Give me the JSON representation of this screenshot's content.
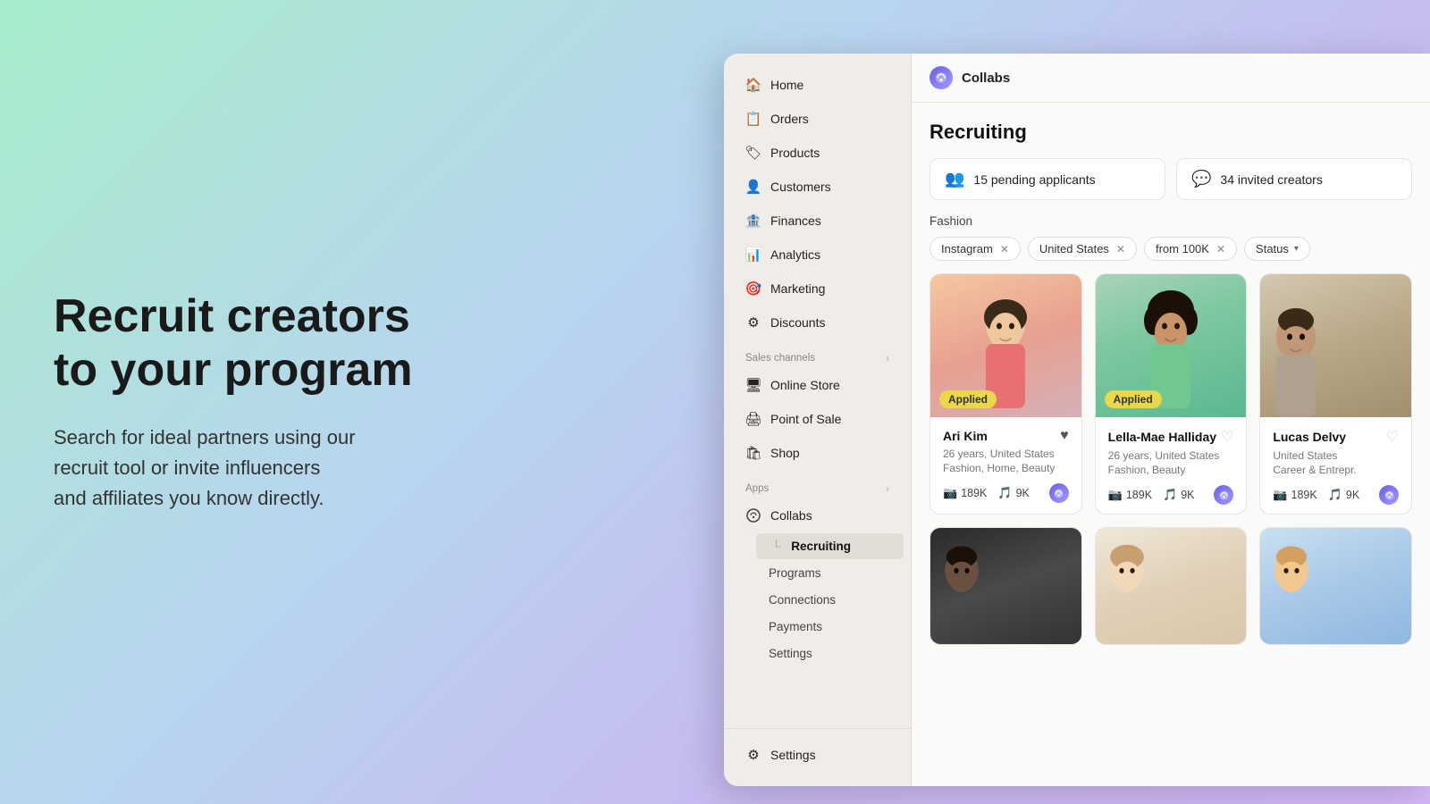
{
  "marketing": {
    "title": "Recruit creators\nto your program",
    "subtitle": "Search for ideal partners using our\nrecruit tool or invite influencers\nand affiliates you know directly."
  },
  "sidebar": {
    "main_items": [
      {
        "id": "home",
        "label": "Home",
        "icon": "🏠"
      },
      {
        "id": "orders",
        "label": "Orders",
        "icon": "📋"
      },
      {
        "id": "products",
        "label": "Products",
        "icon": "🏷"
      },
      {
        "id": "customers",
        "label": "Customers",
        "icon": "👤"
      },
      {
        "id": "finances",
        "label": "Finances",
        "icon": "🏦"
      },
      {
        "id": "analytics",
        "label": "Analytics",
        "icon": "📊"
      },
      {
        "id": "marketing",
        "label": "Marketing",
        "icon": "🎯"
      },
      {
        "id": "discounts",
        "label": "Discounts",
        "icon": "⚙"
      }
    ],
    "sales_channels_label": "Sales channels",
    "sales_channels": [
      {
        "id": "online-store",
        "label": "Online Store",
        "icon": "🖥"
      },
      {
        "id": "pos",
        "label": "Point of Sale",
        "icon": "🖨"
      },
      {
        "id": "shop",
        "label": "Shop",
        "icon": "🛍"
      }
    ],
    "apps_label": "Apps",
    "apps": [
      {
        "id": "collabs",
        "label": "Collabs",
        "icon": "🔄",
        "active": false
      }
    ],
    "collabs_sub": [
      {
        "id": "recruiting",
        "label": "Recruiting",
        "active": true
      },
      {
        "id": "programs",
        "label": "Programs",
        "active": false
      },
      {
        "id": "connections",
        "label": "Connections",
        "active": false
      },
      {
        "id": "payments",
        "label": "Payments",
        "active": false
      },
      {
        "id": "settings",
        "label": "Settings",
        "active": false
      }
    ],
    "bottom": {
      "label": "Settings",
      "icon": "⚙"
    }
  },
  "topbar": {
    "app_name": "Collabs"
  },
  "main": {
    "page_title": "Recruiting",
    "stats": [
      {
        "id": "pending",
        "icon": "👥",
        "text": "15 pending applicants"
      },
      {
        "id": "invited",
        "icon": "💬",
        "text": "34 invited creators"
      }
    ],
    "filter_category": "Fashion",
    "filters": [
      {
        "id": "instagram",
        "label": "Instagram",
        "removable": true
      },
      {
        "id": "united-states",
        "label": "United States",
        "removable": true
      },
      {
        "id": "from-100k",
        "label": "from 100K",
        "removable": true
      },
      {
        "id": "status",
        "label": "Status",
        "removable": false,
        "dropdown": true
      }
    ],
    "creators": [
      {
        "id": "ari-kim",
        "name": "Ari Kim",
        "age": "26 years",
        "location": "United States",
        "tags": "Fashion, Home, Beauty",
        "instagram": "189K",
        "tiktok": "9K",
        "applied": true,
        "hearted": true,
        "photo_class": "photo-1"
      },
      {
        "id": "lella-mae-halliday",
        "name": "Lella-Mae Halliday",
        "age": "26 years",
        "location": "United States",
        "tags": "Fashion, Beauty",
        "instagram": "189K",
        "tiktok": "9K",
        "applied": true,
        "hearted": false,
        "photo_class": "photo-2"
      },
      {
        "id": "lucas-delvy",
        "name": "Lucas Delvy",
        "age": "",
        "location": "United States",
        "tags": "Career & Entrepr.",
        "instagram": "189K",
        "tiktok": "9K",
        "applied": false,
        "hearted": false,
        "photo_class": "photo-3"
      },
      {
        "id": "creator-4",
        "name": "",
        "age": "",
        "location": "",
        "tags": "",
        "instagram": "",
        "tiktok": "",
        "applied": false,
        "hearted": false,
        "photo_class": "photo-4"
      },
      {
        "id": "creator-5",
        "name": "",
        "age": "",
        "location": "",
        "tags": "",
        "instagram": "",
        "tiktok": "",
        "applied": false,
        "hearted": false,
        "photo_class": "photo-5"
      },
      {
        "id": "creator-6",
        "name": "",
        "age": "",
        "location": "",
        "tags": "",
        "instagram": "",
        "tiktok": "",
        "applied": false,
        "hearted": false,
        "photo_class": "photo-6"
      }
    ]
  }
}
